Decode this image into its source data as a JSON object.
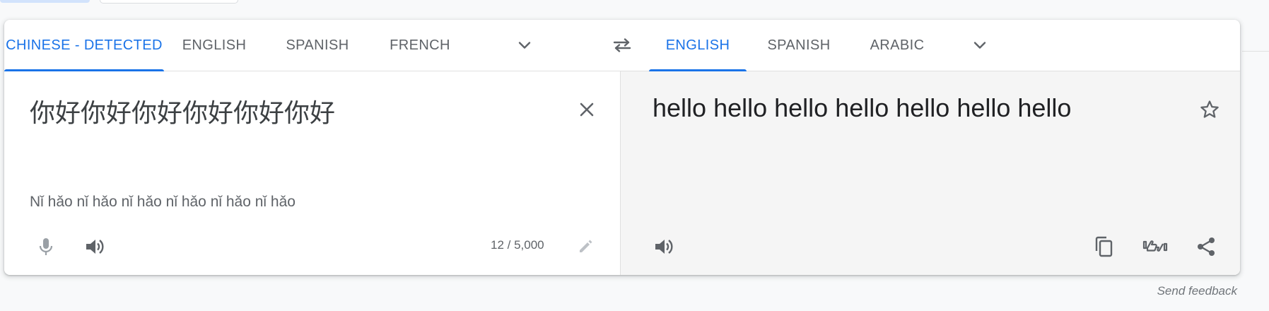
{
  "source": {
    "tabs": [
      "CHINESE - DETECTED",
      "ENGLISH",
      "SPANISH",
      "FRENCH"
    ],
    "text": "你好你好你好你好你好你好",
    "romanization": "Nǐ hǎo nǐ hǎo nǐ hǎo nǐ hǎo nǐ hǎo nǐ hǎo",
    "char_count": "12 / 5,000"
  },
  "target": {
    "tabs": [
      "ENGLISH",
      "SPANISH",
      "ARABIC"
    ],
    "text": "hello hello hello hello hello hello hello"
  },
  "footer": {
    "feedback": "Send feedback"
  },
  "icons": {
    "more_source": "chevron-down-icon",
    "swap": "swap-arrows-icon",
    "more_target": "chevron-down-icon",
    "clear": "close-icon",
    "mic": "microphone-icon",
    "listen_source": "speaker-icon",
    "edit": "pencil-icon",
    "star": "star-outline-icon",
    "listen_target": "speaker-icon",
    "copy": "copy-icon",
    "rate": "rate-translation-icon",
    "share": "share-icon"
  },
  "colors": {
    "accent": "#1a73e8",
    "target_bg": "#f5f5f5",
    "tab_text": "#5f6368"
  }
}
